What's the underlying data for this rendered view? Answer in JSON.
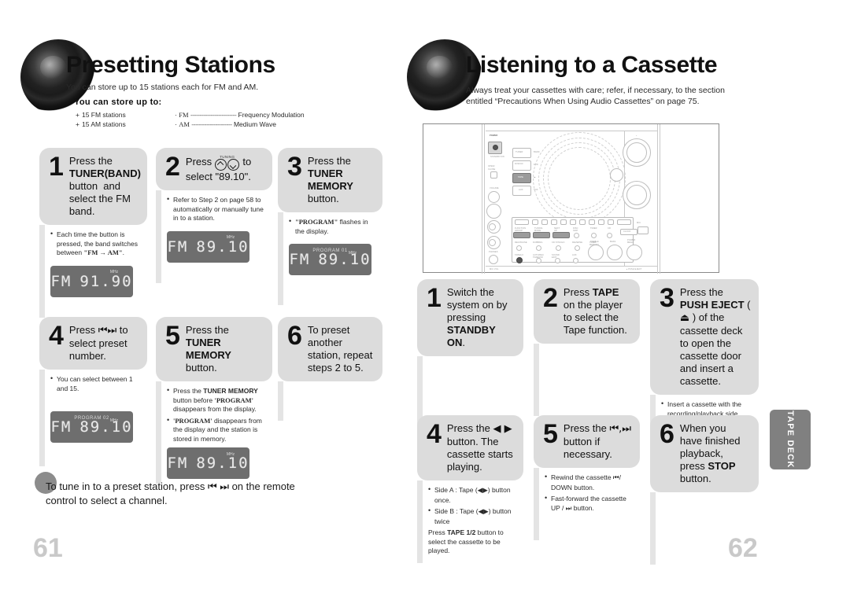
{
  "left_page": {
    "title": "Presetting Stations",
    "subtitle": "You can store up to 15 stations each for FM and AM.",
    "store_heading": "You can store up to:",
    "store_items": [
      "15 FM stations",
      "15 AM stations"
    ],
    "band_items": [
      {
        "code": "FM",
        "dots": "-------------------------",
        "meaning": "Frequency Modulation"
      },
      {
        "code": "AM",
        "dots": "----------------------",
        "meaning": "Medium Wave"
      }
    ],
    "steps": [
      {
        "num": "1",
        "text_html": "Press the <b>TUNER(BAND)</b> button&nbsp; and select the FM band.",
        "notes": [
          {
            "style": "bulleted",
            "html": "Each time the button is pressed, the band switches between <b class=\"serif\">\"FM → AM\"</b>."
          }
        ],
        "lcd": {
          "top": "",
          "fm": "FM",
          "freq": "91.90",
          "unit": "MHz"
        }
      },
      {
        "num": "2",
        "text_html": "Press <span class=\"knob-pair\"><span class=\"tuning-lbl\">TUNING</span><span class=\"knob up\"></span><span class=\"knob down\"></span></span> to select \"89.10\".",
        "notes": [
          {
            "style": "bulleted",
            "html": "Refer to Step 2 on page 58 to automatically or manually tune in to a station."
          }
        ],
        "lcd": {
          "top": "",
          "fm": "FM",
          "freq": "89.10",
          "unit": "MHz"
        }
      },
      {
        "num": "3",
        "text_html": "Press the <b>TUNER MEMORY</b> button.",
        "notes": [
          {
            "style": "bulleted",
            "html": "<b class=\"serif\">\"PROGRAM\"</b> flashes in the display."
          }
        ],
        "lcd": {
          "top": "PROGRAM 01",
          "fm": "FM",
          "freq": "89.10",
          "unit": "MHz"
        }
      },
      {
        "num": "4",
        "text_html": "Press <span class=\"gl\">⏮⏭</span> to select preset number.",
        "notes": [
          {
            "style": "bulleted",
            "html": "You can select between 1 and 15."
          }
        ],
        "lcd": {
          "top": "PROGRAM 02",
          "fm": "FM",
          "freq": "89.10",
          "unit": "MHz"
        }
      },
      {
        "num": "5",
        "text_html": "Press the <b>TUNER MEMORY</b> button.",
        "notes": [
          {
            "style": "bulleted",
            "html": "Press the <b>TUNER MEMORY</b> button before <b class=\"serif\">'PROGRAM'</b> disappears from the display."
          },
          {
            "style": "bulleted",
            "html": "<b class=\"serif\">'PROGRAM'</b> disappears from the display and the station is stored in memory."
          }
        ],
        "lcd": {
          "top": "",
          "fm": "FM",
          "freq": "89.10",
          "unit": "MHz"
        }
      },
      {
        "num": "6",
        "text_html": "To preset another station, repeat steps 2 to 5.",
        "notes": [],
        "lcd": null
      }
    ],
    "tip": "To tune in to a preset station, press ⏮ ⏭ on the remote control to select a channel.",
    "page_number": "61"
  },
  "right_page": {
    "title": "Listening to a Cassette",
    "subtitle": "Always treat your cassettes with care; refer, if necessary, to the section entitled “Precautions When Using Audio Cassettes” on page 75.",
    "device_labels": {
      "power": "POWER",
      "standby": "STANDBY/ON",
      "open_close": "OPEN/CLOSE",
      "buttons": [
        "TUNER",
        "BAND",
        "DVD/CD",
        "TAPE",
        "AUX"
      ],
      "row_labels": [
        "FUNCTION",
        "TUNING",
        "TAPE"
      ],
      "volume": "VOLUME",
      "phones": "PHONES",
      "bass": "BASS",
      "treble": "TREBLE",
      "mic": "MIC"
    },
    "steps": [
      {
        "num": "1",
        "text_html": "Switch the system on by pressing <b>STANDBY ON</b>.",
        "notes": []
      },
      {
        "num": "2",
        "text_html": "Press <b>TAPE</b> on the player to select the Tape function.",
        "notes": []
      },
      {
        "num": "3",
        "text_html": "Press the <b>PUSH EJECT</b> ( <span class=\"gl\">⏏</span> ) of the cassette deck to open the cassette door and insert a cassette.",
        "notes": [
          {
            "style": "bulleted",
            "html": "Insert a cassette with the recording/playback side facing the cassette holder, and then push the cassette door shut."
          }
        ]
      },
      {
        "num": "4",
        "text_html": "Press the <span class=\"gl\">◀ ▶</span> button. The cassette starts playing.",
        "notes": [
          {
            "style": "bulleted",
            "html": "Side A : Tape (<span class=\"gl\">◀▶</span>) button once."
          },
          {
            "style": "bulleted",
            "html": "Side B : Tape (<span class=\"gl\">◀▶</span>) button twice"
          },
          {
            "style": "plain",
            "html": "Press <b>TAPE 1/2</b> button to select the cassette to be played."
          }
        ]
      },
      {
        "num": "5",
        "text_html": "Press the <span class=\"gl\">⏮,⏭</span> button if necessary.",
        "notes": [
          {
            "style": "bulleted",
            "html": "Rewind the cassette <span class=\"gl\">⏮</span>/ DOWN button."
          },
          {
            "style": "bulleted",
            "html": "Fast-forward the cassette UP / <span class=\"gl\">⏭</span> button."
          }
        ]
      },
      {
        "num": "6",
        "text_html": "When you have finished playback, press <b>STOP</b> button.",
        "notes": []
      }
    ],
    "tab_label": "TAPE DECK",
    "page_number": "62"
  },
  "colors": {
    "step_header_bg": "#dcdcdc",
    "step_rail": "#e4e4e4",
    "lcd_bg": "#6e6e6e",
    "tab_bg": "#808080",
    "page_number": "#c9c9c9",
    "tip_dot": "#8c8c8c"
  }
}
